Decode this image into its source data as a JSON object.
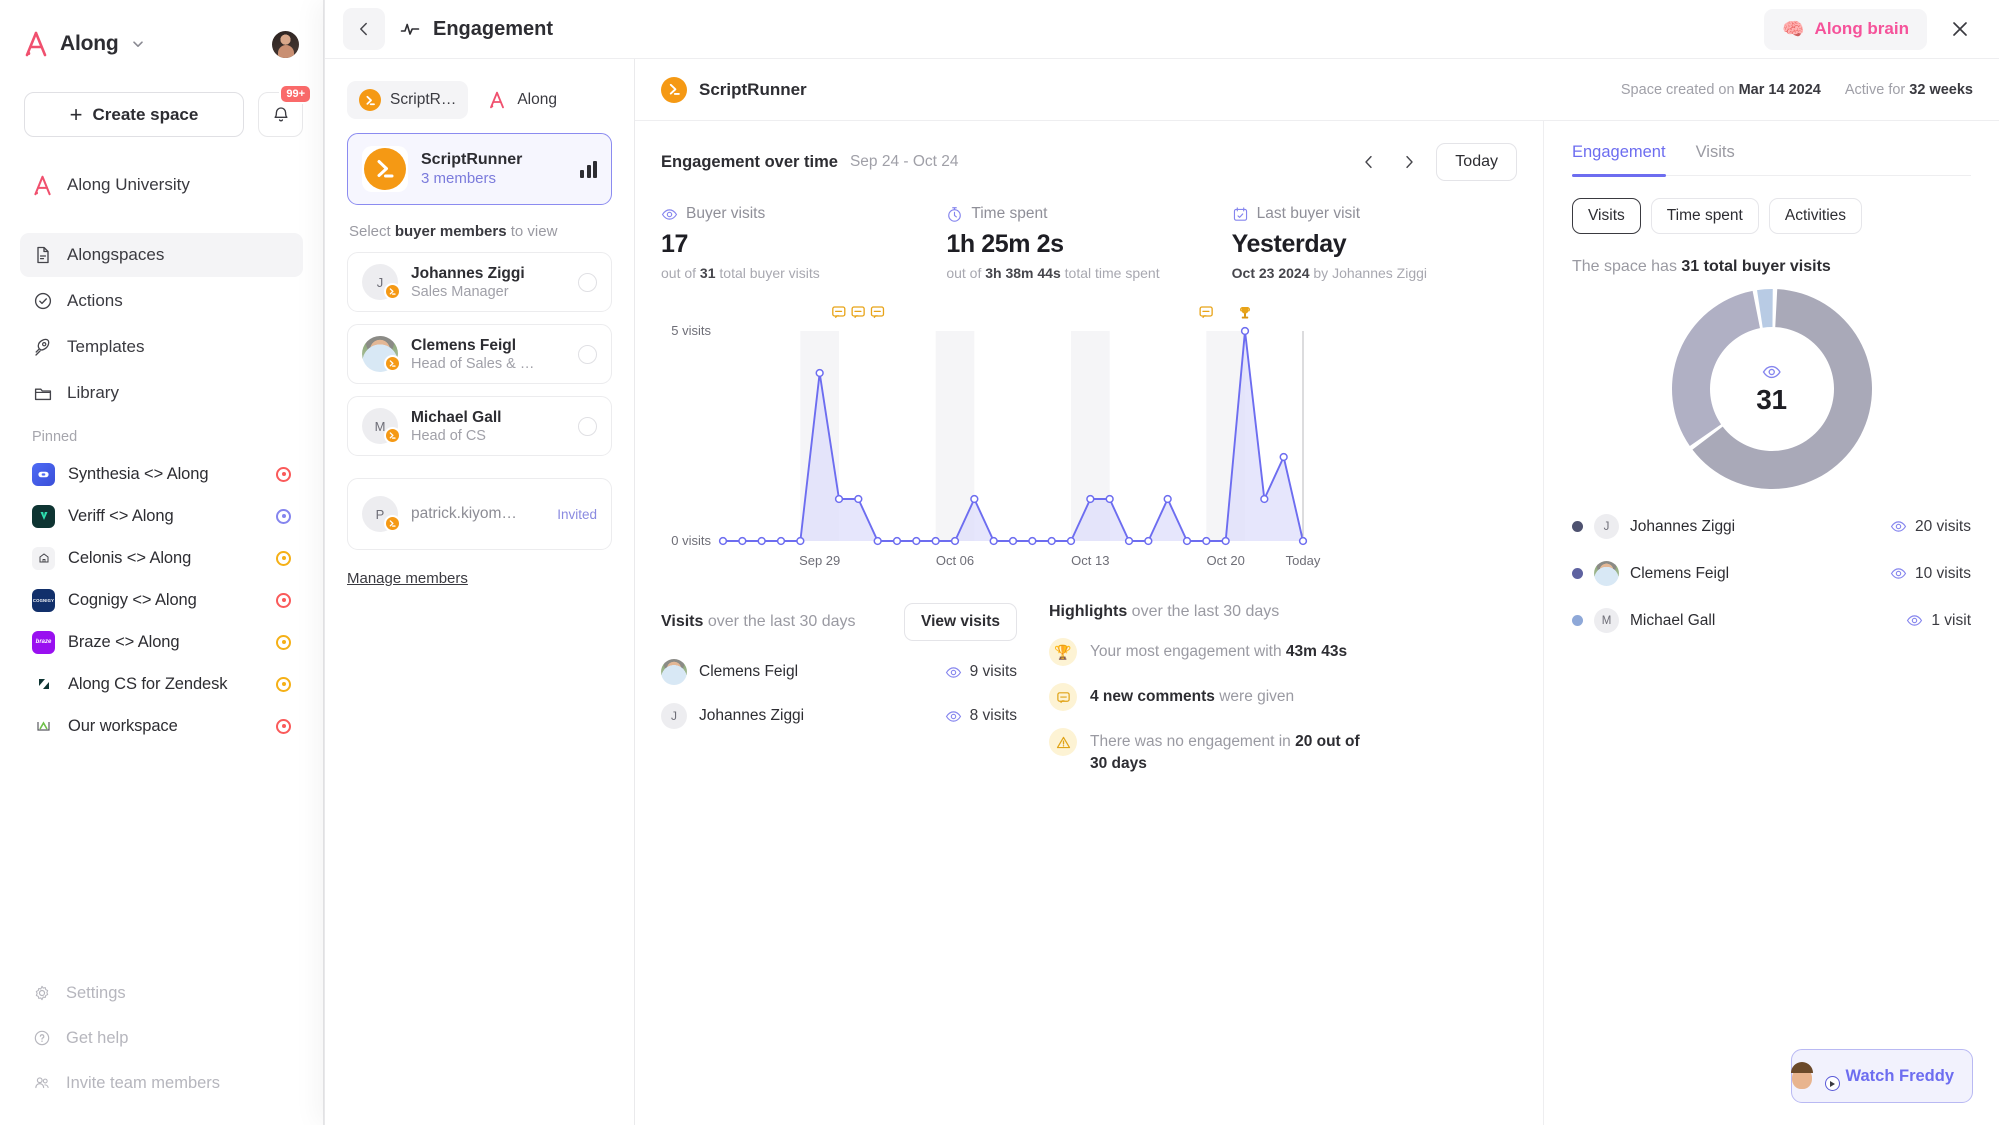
{
  "sidebar": {
    "workspace_name": "Along",
    "create_space_label": "Create space",
    "notification_badge": "99+",
    "university_label": "Along University",
    "nav_items": [
      {
        "label": "Alongspaces",
        "icon": "document-icon",
        "active": true
      },
      {
        "label": "Actions",
        "icon": "check-circle-icon",
        "active": false
      },
      {
        "label": "Templates",
        "icon": "rocket-icon",
        "active": false
      },
      {
        "label": "Library",
        "icon": "folder-icon",
        "active": false
      }
    ],
    "pinned_label": "Pinned",
    "pinned": [
      {
        "label": "Synthesia <> Along",
        "status_color": "#fa5a5a",
        "logo_bg": "#3c5ae8",
        "logo_text": ""
      },
      {
        "label": "Veriff <> Along",
        "status_color": "#8585ee",
        "logo_bg": "#0e3432",
        "logo_text": ""
      },
      {
        "label": "Celonis <> Along",
        "status_color": "#f5b016",
        "logo_bg": "#f2f2f4",
        "logo_text": ""
      },
      {
        "label": "Cognigy <> Along",
        "status_color": "#fa5a5a",
        "logo_bg": "#12306b",
        "logo_text": "COGNIGY"
      },
      {
        "label": "Braze <> Along",
        "status_color": "#f5b016",
        "logo_bg": "#9910f0",
        "logo_text": "braze"
      },
      {
        "label": "Along CS for Zendesk",
        "status_color": "#f5b016",
        "logo_bg": "#ffffff",
        "logo_text": ""
      },
      {
        "label": "Our workspace",
        "status_color": "#fa5a5a",
        "logo_bg": "#ffffff",
        "logo_text": ""
      }
    ],
    "bottom_items": [
      {
        "label": "Settings",
        "icon": "gear-icon"
      },
      {
        "label": "Get help",
        "icon": "question-circle-icon"
      },
      {
        "label": "Invite team members",
        "icon": "people-icon"
      }
    ]
  },
  "panel": {
    "title": "Engagement",
    "brain_button": "Along brain",
    "back_icon": "chevron-left-icon",
    "close_icon": "close-icon"
  },
  "members": {
    "tabs": [
      {
        "label": "ScriptR…",
        "active": true,
        "icon": "scriptrunner-icon"
      },
      {
        "label": "Along",
        "active": false,
        "icon": "along-icon"
      }
    ],
    "space": {
      "name": "ScriptRunner",
      "members_count": "3 members",
      "chart_icon": "bar-chart-icon"
    },
    "select_hint_pre": "Select ",
    "select_hint_bold": "buyer members",
    "select_hint_post": " to view",
    "list": [
      {
        "name": "Johannes Ziggi",
        "role": "Sales Manager",
        "initial": "J",
        "type": "member"
      },
      {
        "name": "Clemens Feigl",
        "role": "Head of Sales & …",
        "initial": "C",
        "type": "member",
        "has_photo": true
      },
      {
        "name": "Michael Gall",
        "role": "Head of CS",
        "initial": "M",
        "type": "member"
      },
      {
        "name": "patrick.kiyom…",
        "role": "",
        "initial": "P",
        "type": "invited",
        "status": "Invited"
      }
    ],
    "manage_link": "Manage members"
  },
  "main_header": {
    "space_name": "ScriptRunner",
    "created_label": "Space created on",
    "created_value": "Mar 14 2024",
    "active_label": "Active for",
    "active_value": "32 weeks"
  },
  "engagement": {
    "title": "Engagement over time",
    "range": "Sep 24 - Oct 24",
    "prev_icon": "chevron-left-icon",
    "next_icon": "chevron-right-icon",
    "today_button": "Today",
    "stats": [
      {
        "icon": "eye-icon",
        "label": "Buyer visits",
        "value": "17",
        "sub_pre": "out of ",
        "sub_bold": "31",
        "sub_post": " total buyer visits"
      },
      {
        "icon": "timer-icon",
        "label": "Time spent",
        "value": "1h 25m 2s",
        "sub_pre": "out of ",
        "sub_bold": "3h 38m 44s",
        "sub_post": " total time spent"
      },
      {
        "icon": "calendar-icon",
        "label": "Last buyer visit",
        "value": "Yesterday",
        "sub_pre": "",
        "sub_bold": "Oct 23 2024",
        "sub_post": " by Johannes Ziggi"
      }
    ]
  },
  "chart_data": {
    "type": "area",
    "title": "Engagement over time",
    "ylabel": "",
    "xlabel": "",
    "ylim": [
      0,
      5
    ],
    "ytick_labels": [
      "0 visits",
      "5 visits"
    ],
    "ytick_values": [
      0,
      5
    ],
    "xtick_labels": [
      "Sep 29",
      "Oct 06",
      "Oct 13",
      "Oct 20",
      "Today"
    ],
    "xtick_indices": [
      5,
      12,
      19,
      26,
      30
    ],
    "grid": false,
    "line_color": "#6d6df0",
    "fill_color": "#dedefb",
    "x": [
      "Sep 24",
      "Sep 25",
      "Sep 26",
      "Sep 27",
      "Sep 28",
      "Sep 29",
      "Sep 30",
      "Oct 01",
      "Oct 02",
      "Oct 03",
      "Oct 04",
      "Oct 05",
      "Oct 06",
      "Oct 07",
      "Oct 08",
      "Oct 09",
      "Oct 10",
      "Oct 11",
      "Oct 12",
      "Oct 13",
      "Oct 14",
      "Oct 15",
      "Oct 16",
      "Oct 17",
      "Oct 18",
      "Oct 19",
      "Oct 20",
      "Oct 21",
      "Oct 22",
      "Oct 23",
      "Oct 24"
    ],
    "values": [
      0,
      0,
      0,
      0,
      0,
      4,
      1,
      1,
      0,
      0,
      0,
      0,
      0,
      1,
      0,
      0,
      0,
      0,
      0,
      1,
      1,
      0,
      0,
      1,
      0,
      0,
      0,
      5,
      1,
      2,
      0
    ],
    "markers": [
      {
        "x_index": 6,
        "icon": "comment-icon",
        "color": "#f5b016"
      },
      {
        "x_index": 7,
        "icon": "comment-icon",
        "color": "#f5b016"
      },
      {
        "x_index": 8,
        "icon": "comment-icon",
        "color": "#f5b016"
      },
      {
        "x_index": 25,
        "icon": "comment-icon",
        "color": "#f5b016"
      },
      {
        "x_index": 27,
        "icon": "trophy-icon",
        "color": "#f5b016"
      }
    ],
    "weekend_bands": [
      [
        4,
        6
      ],
      [
        11,
        13
      ],
      [
        18,
        20
      ],
      [
        25,
        27
      ]
    ]
  },
  "visits_section": {
    "title_bold": "Visits",
    "title_rest": " over the last 30 days",
    "view_button": "View visits",
    "rows": [
      {
        "name": "Clemens Feigl",
        "initial": "C",
        "count": "9 visits",
        "has_photo": true
      },
      {
        "name": "Johannes Ziggi",
        "initial": "J",
        "count": "8 visits",
        "has_photo": false
      }
    ]
  },
  "highlights_section": {
    "title_bold": "Highlights",
    "title_rest": " over the last 30 days",
    "rows": [
      {
        "icon": "trophy-icon",
        "glyph": "🏆",
        "pre": "Your most engagement with ",
        "bold": "43m 43s",
        "post": ""
      },
      {
        "icon": "comment-icon",
        "glyph": "💬",
        "pre": "",
        "bold": "4 new comments",
        "post": " were given"
      },
      {
        "icon": "warning-icon",
        "glyph": "⚠",
        "pre": "There was no engagement in ",
        "bold": "20 out of 30 days",
        "post": ""
      }
    ]
  },
  "right_panel": {
    "tabs": [
      {
        "label": "Engagement",
        "active": true
      },
      {
        "label": "Visits",
        "active": false
      }
    ],
    "pills": [
      {
        "label": "Visits",
        "active": true
      },
      {
        "label": "Time spent",
        "active": false
      },
      {
        "label": "Activities",
        "active": false
      }
    ],
    "summary_pre": "The space has ",
    "summary_bold": "31 total buyer visits",
    "donut": {
      "type": "pie",
      "center_value": "31",
      "center_icon": "eye-icon",
      "total": 31,
      "labels": [
        "Johannes Ziggi",
        "Clemens Feigl",
        "Michael Gall"
      ],
      "values": [
        20,
        10,
        1
      ],
      "colors": [
        "#a9a9b8",
        "#b0b0c4",
        "#b8cbe4"
      ]
    },
    "legend": [
      {
        "name": "Johannes Ziggi",
        "initial": "J",
        "count": "20 visits",
        "dot": "#4e5270",
        "has_photo": false
      },
      {
        "name": "Clemens Feigl",
        "initial": "C",
        "count": "10 visits",
        "dot": "#5e62a0",
        "has_photo": true
      },
      {
        "name": "Michael Gall",
        "initial": "M",
        "count": "1 visit",
        "dot": "#8ea8d8",
        "has_photo": false
      }
    ]
  },
  "freddy": {
    "label": "Watch Freddy"
  }
}
